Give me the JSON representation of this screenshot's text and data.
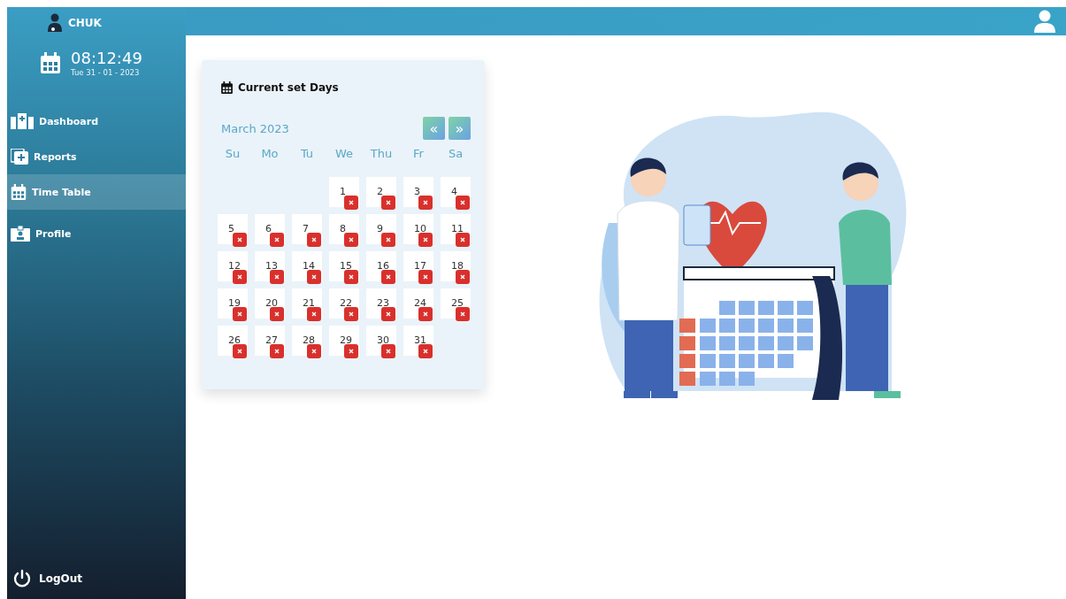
{
  "brand": {
    "name": "CHUK"
  },
  "clock": {
    "time": "08:12:49",
    "date": "Tue 31 - 01 - 2023"
  },
  "sidebar": {
    "items": [
      {
        "label": "Dashboard",
        "selected": false
      },
      {
        "label": "Reports",
        "selected": false
      },
      {
        "label": "Time Table",
        "selected": true
      },
      {
        "label": "Profile",
        "selected": false
      }
    ],
    "logout": {
      "label": "LogOut"
    }
  },
  "card": {
    "title": "Current set Days",
    "month": "March 2023",
    "prev": "«",
    "next": "»",
    "weekdays": [
      "Su",
      "Mo",
      "Tu",
      "We",
      "Thu",
      "Fr",
      "Sa"
    ],
    "weeks": [
      {
        "kind": "end",
        "days": [
          "1",
          "2",
          "3",
          "4"
        ]
      },
      {
        "kind": "full",
        "days": [
          "5",
          "6",
          "7",
          "8",
          "9",
          "10",
          "11"
        ]
      },
      {
        "kind": "full",
        "days": [
          "12",
          "13",
          "14",
          "15",
          "16",
          "17",
          "18"
        ]
      },
      {
        "kind": "full",
        "days": [
          "19",
          "20",
          "21",
          "22",
          "23",
          "24",
          "25"
        ]
      },
      {
        "kind": "start",
        "days": [
          "26",
          "27",
          "28",
          "29",
          "30",
          "31"
        ]
      }
    ]
  }
}
